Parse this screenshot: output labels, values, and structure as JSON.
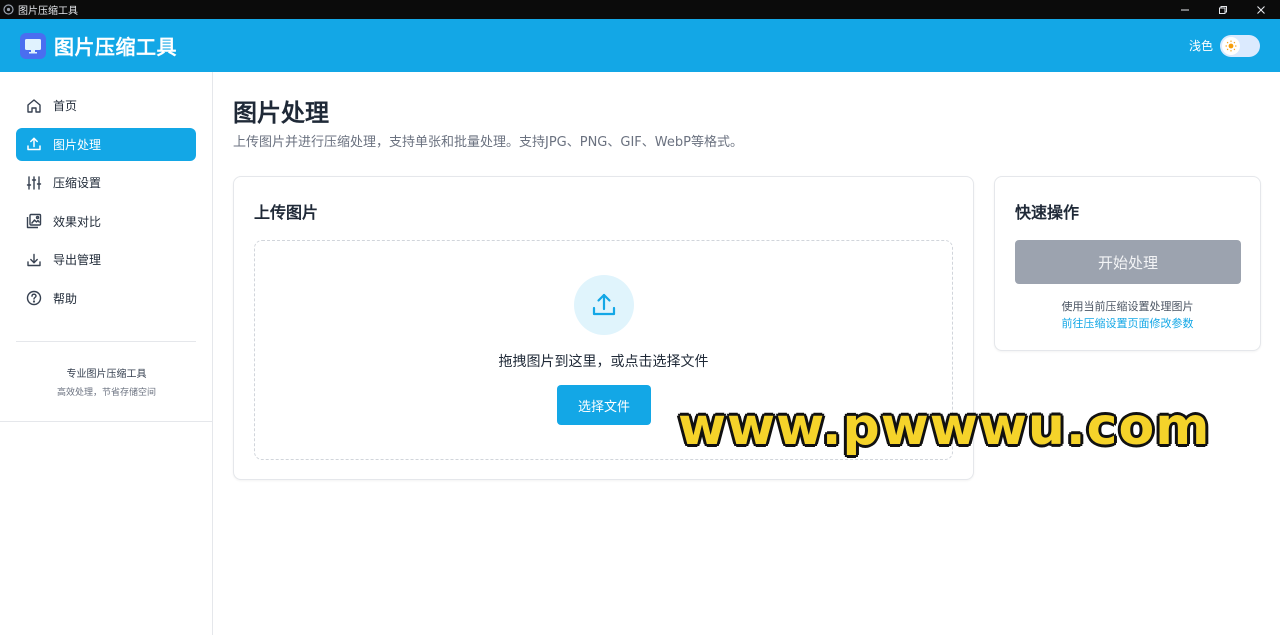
{
  "window": {
    "title": "图片压缩工具",
    "controls": [
      "minimize",
      "restore",
      "close"
    ]
  },
  "header": {
    "brand": "图片压缩工具",
    "theme_label": "浅色",
    "theme_mode": "light"
  },
  "sidebar": {
    "items": [
      {
        "label": "首页",
        "icon": "home-icon",
        "active": false
      },
      {
        "label": "图片处理",
        "icon": "upload-icon",
        "active": true
      },
      {
        "label": "压缩设置",
        "icon": "sliders-icon",
        "active": false
      },
      {
        "label": "效果对比",
        "icon": "image-compare-icon",
        "active": false
      },
      {
        "label": "导出管理",
        "icon": "download-icon",
        "active": false
      },
      {
        "label": "帮助",
        "icon": "help-icon",
        "active": false
      }
    ],
    "footer_title": "专业图片压缩工具",
    "footer_subtitle": "高效处理，节省存储空间"
  },
  "main": {
    "title": "图片处理",
    "description": "上传图片并进行压缩处理，支持单张和批量处理。支持JPG、PNG、GIF、WebP等格式。",
    "upload_card": {
      "title": "上传图片",
      "drop_text": "拖拽图片到这里，或点击选择文件",
      "choose_button": "选择文件"
    },
    "quick_card": {
      "title": "快速操作",
      "start_button": "开始处理",
      "hint": "使用当前压缩设置处理图片",
      "link": "前往压缩设置页面修改参数"
    }
  },
  "watermark": "www.pwwwu.com",
  "colors": {
    "accent": "#13a7e6",
    "disabled": "#9ca3af",
    "watermark": "#f5d32a"
  }
}
